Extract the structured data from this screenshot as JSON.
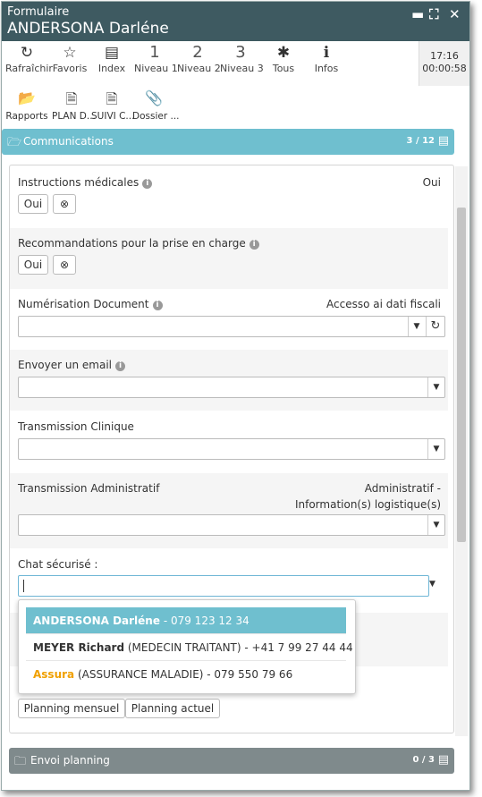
{
  "window": {
    "subtitle": "Formulaire",
    "title": "ANDERSONA Darléne",
    "controls": {
      "minimize": "▬",
      "maximize": "⛶",
      "close": "✕"
    }
  },
  "toolbar": {
    "items": [
      {
        "label": "Rafraîchir",
        "icon": "refresh-icon",
        "glyph": "↻"
      },
      {
        "label": "Favoris",
        "icon": "star-icon",
        "glyph": "☆"
      },
      {
        "label": "Index",
        "icon": "list-icon",
        "glyph": "▤"
      },
      {
        "label": "Niveau 1",
        "num": "1"
      },
      {
        "label": "Niveau 2",
        "num": "2"
      },
      {
        "label": "Niveau 3",
        "num": "3"
      },
      {
        "label": "Tous",
        "icon": "asterisk-icon",
        "glyph": "✱"
      },
      {
        "label": "Infos",
        "icon": "info-icon",
        "glyph": "ℹ"
      }
    ],
    "clock_time": "17:16",
    "clock_elapsed": "00:00:58"
  },
  "toolbar2": {
    "items": [
      {
        "label": "Rapports",
        "icon": "folder-open-icon",
        "glyph": "📂"
      },
      {
        "label": "PLAN D...",
        "icon": "document-icon",
        "glyph": "🗎"
      },
      {
        "label": "SUIVI C...",
        "icon": "document-chart-icon",
        "glyph": "🗎"
      },
      {
        "label": "Dossier ...",
        "icon": "paperclip-icon",
        "glyph": "📎"
      }
    ]
  },
  "sections": {
    "communications": {
      "title": "Communications",
      "count": "3 / 12",
      "color": "#6fbfcf"
    },
    "envoi": {
      "title": "Envoi planning",
      "count": "0 / 3",
      "color": "#7f8a8c"
    }
  },
  "fields": {
    "instructions": {
      "label": "Instructions médicales",
      "right": "Oui",
      "btn": "Oui"
    },
    "recommandations": {
      "label": "Recommandations pour la prise en charge",
      "btn": "Oui"
    },
    "numerisation": {
      "label": "Numérisation Document",
      "right": "Accesso ai dati fiscali"
    },
    "email": {
      "label": "Envoyer un email"
    },
    "clinique": {
      "label": "Transmission Clinique"
    },
    "administratif": {
      "label": "Transmission Administratif",
      "right1": "Administratif -",
      "right2": "Information(s) logistique(s)"
    },
    "chat": {
      "label": "Chat sécurisé :",
      "value": ""
    }
  },
  "dropdown": {
    "items": [
      {
        "name": "ANDERSONA Darléne",
        "rest": " - 079 123 12 34"
      },
      {
        "name": "MEYER Richard",
        "rest": " (MEDECIN TRAITANT) - +41 7 99 27 44 44"
      },
      {
        "name": "Assura",
        "rest": " (ASSURANCE MALADIE) - 079 550 79 66",
        "accent": "#f0a000"
      }
    ]
  },
  "planning": {
    "mensuel": "Planning mensuel",
    "actuel": "Planning actuel"
  }
}
